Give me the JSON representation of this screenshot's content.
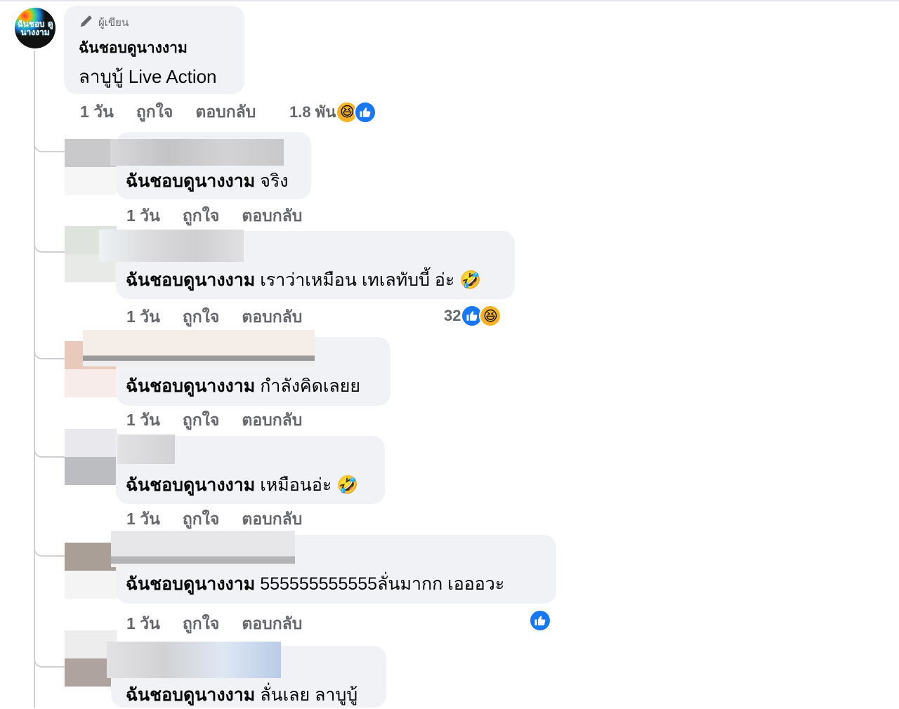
{
  "main_comment": {
    "author_badge": "ผู้เขียน",
    "author_name": "ฉันชอบดูนางงาม",
    "text": "ลาบูบู้ Live Action",
    "time": "1 วัน",
    "like_label": "ถูกใจ",
    "reply_label": "ตอบกลับ",
    "reaction_count": "1.8 พัน",
    "avatar_logo": "ฉันชอบ ดูนางงาม"
  },
  "replies": [
    {
      "author": "ฉันชอบดูนางงาม",
      "text": "จริง",
      "time": "1 วัน",
      "like_label": "ถูกใจ",
      "reply_label": "ตอบกลับ",
      "reaction_count": ""
    },
    {
      "author": "ฉันชอบดูนางงาม",
      "text": "เราว่าเหมือน เทเลทับบี้ อ่ะ 🤣",
      "time": "1 วัน",
      "like_label": "ถูกใจ",
      "reply_label": "ตอบกลับ",
      "reaction_count": "32"
    },
    {
      "author": "ฉันชอบดูนางงาม",
      "text": "กำลังคิดเลยย",
      "time": "1 วัน",
      "like_label": "ถูกใจ",
      "reply_label": "ตอบกลับ",
      "reaction_count": ""
    },
    {
      "author": "ฉันชอบดูนางงาม",
      "text": "เหมือนอ่ะ 🤣",
      "time": "1 วัน",
      "like_label": "ถูกใจ",
      "reply_label": "ตอบกลับ",
      "reaction_count": ""
    },
    {
      "author": "ฉันชอบดูนางงาม",
      "text": "555555555555ลั่นมากก เอออวะ",
      "time": "1 วัน",
      "like_label": "ถูกใจ",
      "reply_label": "ตอบกลับ",
      "reaction_count": ""
    },
    {
      "author": "ฉันชอบดูนางงาม",
      "text": "ลั่นเลย ลาบูบู้",
      "time": "",
      "like_label": "",
      "reply_label": "",
      "reaction_count": ""
    }
  ],
  "icons": {
    "author_badge": "pencil-icon",
    "like_reaction": "like-reaction-icon",
    "haha_reaction": "haha-reaction-icon"
  },
  "colors": {
    "bubble": "#f0f2f5",
    "like": "#1877f2",
    "haha": "#f7b125",
    "meta_text": "#65676b"
  }
}
